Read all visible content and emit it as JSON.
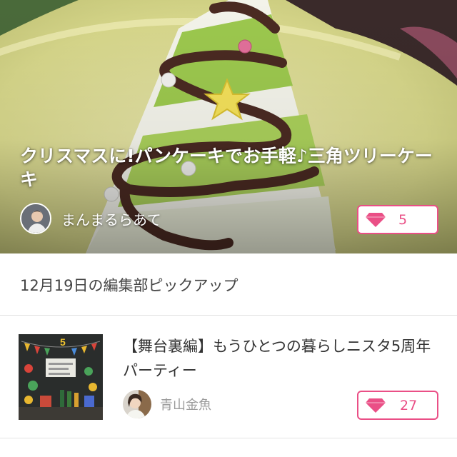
{
  "featured": {
    "title": "クリスマスに!パンケーキでお手軽♪三角ツリーケーキ",
    "author": "まんまるらあて",
    "like_count": "5",
    "like_icon": "diamond-icon"
  },
  "section": {
    "title": "12月19日の編集部ピックアップ"
  },
  "articles": [
    {
      "title": "【舞台裏編】もうひとつの暮らしニスタ5周年パーティー",
      "author": "青山金魚",
      "like_count": "27",
      "like_icon": "diamond-icon"
    }
  ],
  "colors": {
    "accent": "#ea4f86",
    "text": "#333333",
    "muted": "#9b9b9b",
    "divider": "#e3e3e3"
  }
}
